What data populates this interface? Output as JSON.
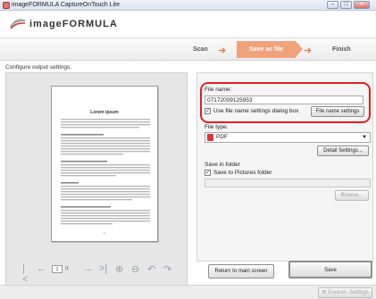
{
  "window": {
    "title": "imageFORMULA CaptureOnTouch Lite",
    "min": "–",
    "max": "□",
    "close": "✕"
  },
  "brand": {
    "name": "imageFORMULA"
  },
  "steps": {
    "scan": "Scan",
    "save": "Save as file",
    "finish": "Finish"
  },
  "instruction": "Configure output settings.",
  "preview": {
    "doc_title": "Lorem ipsum",
    "page": "1",
    "page_total": "/1"
  },
  "settings": {
    "file_name_label": "File name:",
    "file_name_value": "07172009125953",
    "use_dialog_label": "Use file name settings dialog box",
    "file_name_settings_button": "File name settings",
    "file_type_label": "File type:",
    "file_type_value": "PDF",
    "detail_settings_button": "Detail Settings...",
    "save_in_label": "Save in folder",
    "save_to_pictures_label": "Save to Pictures folder",
    "browse_button": "Browse..."
  },
  "actions": {
    "return": "Return to main screen",
    "save": "Save"
  },
  "footer": {
    "env_settings": "Environ. Settings"
  }
}
